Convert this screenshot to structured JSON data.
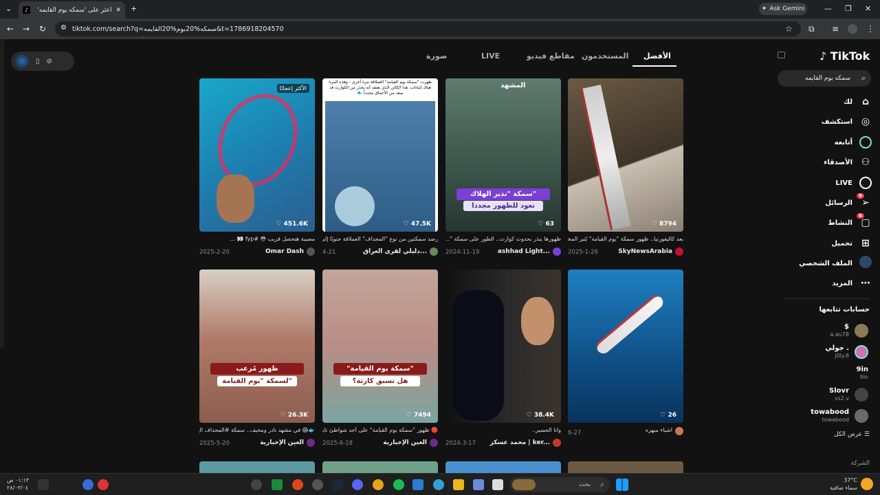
{
  "browser": {
    "tab_title": "اعثر على 'سمكه يوم القايمه'",
    "tab_favicon": "tiktok-favicon",
    "ask_gemini": "Ask Gemini",
    "url": "tiktok.com/search?q=سمكه%20يوم%20القايمه&t=1786918204570"
  },
  "search_tabs": [
    "الأفضل",
    "المستخدمون",
    "مقاطع فيديو",
    "LIVE",
    "صورة"
  ],
  "sidebar": {
    "logo": "TikTok",
    "search_value": "سمكه يوم القايمه",
    "nav": [
      {
        "label": "لك",
        "icon": "home-icon"
      },
      {
        "label": "استكشف",
        "icon": "compass-icon"
      },
      {
        "label": "أتابعه",
        "icon": "following-icon"
      },
      {
        "label": "الأصدقاء",
        "icon": "friends-icon"
      },
      {
        "label": "LIVE",
        "icon": "live-icon"
      },
      {
        "label": "الرسائل",
        "icon": "messages-icon",
        "badge": "9"
      },
      {
        "label": "النشاط",
        "icon": "activity-icon",
        "badge": "6"
      },
      {
        "label": "تحميل",
        "icon": "upload-icon"
      },
      {
        "label": "الملف الشخصي",
        "icon": "profile-icon"
      },
      {
        "label": "المزيد",
        "icon": "more-icon"
      }
    ],
    "following_title": "حسابات تتابعها",
    "following": [
      {
        "name": "$",
        "handle": "a.au78"
      },
      {
        "name": "جولي .",
        "handle": "j0ly.8"
      },
      {
        "name": "9in",
        "handle": "9in"
      },
      {
        "name": "Slovr",
        "handle": "ss2.v"
      },
      {
        "name": "towabood",
        "handle": "towabood"
      }
    ],
    "see_all": "عرض الكل",
    "company": "الشركة"
  },
  "videos": [
    {
      "likes": "8794",
      "desc": "بعد كاليفورنيا.. ظهور سمكة \"يوم القيامة\" يُثير المخا...",
      "author": "SkyNewsArabia",
      "date": "2025-1-26"
    },
    {
      "likes": "63",
      "desc": "ظهورها ينذر بحدوث كوارث.. الطور على سمكة \"...",
      "author": "ashhad Light...",
      "date": "2024-11-19",
      "overlay1": "سمكة \"نذير الهلاك\"",
      "overlay2": "تعود للظهور مجددا",
      "watermark": "المشهد"
    },
    {
      "likes": "47.5K",
      "desc": "رصد سمكتين من نوع \"المجداف\" العملاقة جنوبًا إلى ...",
      "author": "دليلي لقرى العراق...",
      "date": "4-21",
      "caption_top": "ظهرت \"سمكة يوم القيامة\" العملاقة مرة أخرى - وهذه المرة هناك إثباتات. هذا الكائن الذي يعتقد أنه يحذر من الكوارث قد صعد من الأعماق مجدداً 🐟"
    },
    {
      "likes": "451.6K",
      "desc": "مصيبة هتحصل قريب 😳 #fyp 👀 ...",
      "author": "Omar Dash",
      "date": "2025-2-20",
      "badge": "الأكثر إعجابًا"
    },
    {
      "likes": "26",
      "desc": "اشياء مبهره",
      "author": "",
      "date": "6-27"
    },
    {
      "likes": "38.4K",
      "desc": "وانا الحسير..",
      "author": "محمد عسكر | ker...",
      "date": "2024-3-17"
    },
    {
      "likes": "7494",
      "desc": "🔴 ظهور \"سمكة يوم القيامة\" على أحد شواطئ تايو...",
      "author": "العين الإخبارية",
      "date": "2025-6-18",
      "overlay1": "\"سمكة يوم القيامة\"",
      "overlay2": "هل تسبق كارثة؟"
    },
    {
      "likes": "26.3K",
      "desc": "🐟😱 في مشهد نادر ومخيف.. سمكة #المجداف الع...",
      "author": "العين الإخبارية",
      "date": "2025-5-20",
      "overlay1": "ظهور مُرعب",
      "overlay2": "لسمكة \"يوم القيامة\""
    }
  ],
  "taskbar": {
    "search_placeholder": "بحث",
    "time": "٠١:١٣ ص",
    "date": "٢٨/٠٣/٠٤",
    "temp": "37°C",
    "weather": "سماء صافية"
  },
  "colors": {
    "accent": "#fe2c55",
    "teal": "#7fe3d9"
  }
}
